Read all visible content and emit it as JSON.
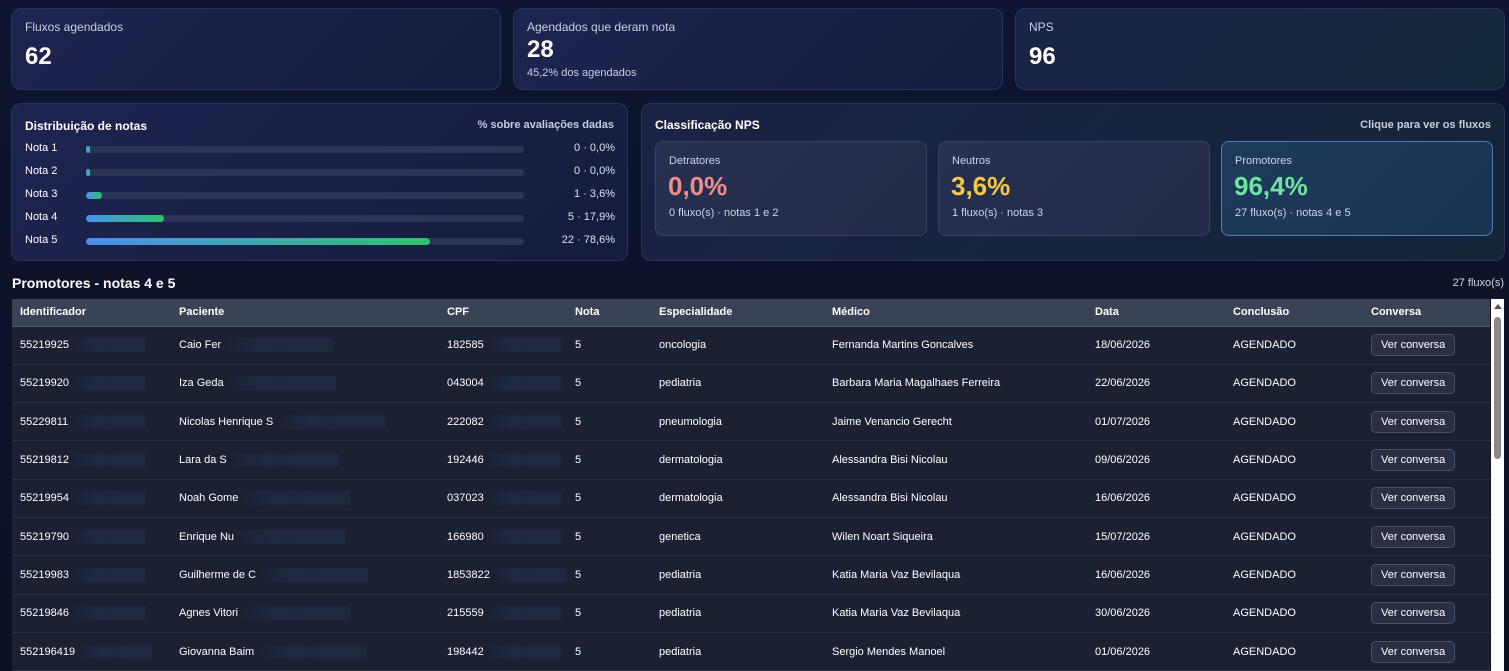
{
  "kpis": [
    {
      "label": "Fluxos agendados",
      "value": "62",
      "sub": ""
    },
    {
      "label": "Agendados que deram nota",
      "value": "28",
      "sub": "45,2% dos agendados"
    },
    {
      "label": "NPS",
      "value": "96",
      "sub": ""
    }
  ],
  "distribution": {
    "title": "Distribuição de notas",
    "hint": "% sobre avaliações dadas",
    "rows": [
      {
        "label": "Nota 1",
        "value_text": "0 · 0,0%",
        "fraction": 0.0
      },
      {
        "label": "Nota 2",
        "value_text": "0 · 0,0%",
        "fraction": 0.0
      },
      {
        "label": "Nota 3",
        "value_text": "1 · 3,6%",
        "fraction": 0.036
      },
      {
        "label": "Nota 4",
        "value_text": "5 · 17,9%",
        "fraction": 0.179
      },
      {
        "label": "Nota 5",
        "value_text": "22 · 78,6%",
        "fraction": 0.786
      }
    ]
  },
  "nps_classification": {
    "title": "Classificação NPS",
    "hint": "Clique para ver os fluxos",
    "boxes": [
      {
        "label": "Detratores",
        "value": "0,0%",
        "sub": "0 fluxo(s) · notas 1 e 2",
        "color": "#f28b8b"
      },
      {
        "label": "Neutros",
        "value": "3,6%",
        "sub": "1 fluxo(s) · notas 3",
        "color": "#f5c842"
      },
      {
        "label": "Promotores",
        "value": "96,4%",
        "sub": "27 fluxo(s) · notas 4 e 5",
        "color": "#6fe3a0"
      }
    ]
  },
  "section": {
    "title": "Promotores - notas 4 e 5",
    "count": "27 fluxo(s)"
  },
  "table": {
    "columns": [
      "Identificador",
      "Paciente",
      "CPF",
      "Nota",
      "Especialidade",
      "Médico",
      "Data",
      "Conclusão",
      "Conversa"
    ],
    "button_label": "Ver conversa",
    "rows": [
      {
        "id": "55219925",
        "paciente": "Caio Fer",
        "cpf": "182585",
        "nota": "5",
        "esp": "oncologia",
        "medico": "Fernanda Martins Goncalves",
        "data": "18/06/2026",
        "conclusao": "AGENDADO"
      },
      {
        "id": "55219920",
        "paciente": "Iza Geda",
        "cpf": "043004",
        "nota": "5",
        "esp": "pediatria",
        "medico": "Barbara Maria Magalhaes Ferreira",
        "data": "22/06/2026",
        "conclusao": "AGENDADO"
      },
      {
        "id": "55229811",
        "paciente": "Nicolas Henrique S",
        "cpf": "222082",
        "nota": "5",
        "esp": "pneumologia",
        "medico": "Jaime Venancio Gerecht",
        "data": "01/07/2026",
        "conclusao": "AGENDADO"
      },
      {
        "id": "55219812",
        "paciente": "Lara da S",
        "cpf": "192446",
        "nota": "5",
        "esp": "dermatologia",
        "medico": "Alessandra Bisi Nicolau",
        "data": "09/06/2026",
        "conclusao": "AGENDADO"
      },
      {
        "id": "55219954",
        "paciente": "Noah Gome",
        "cpf": "037023",
        "nota": "5",
        "esp": "dermatologia",
        "medico": "Alessandra Bisi Nicolau",
        "data": "16/06/2026",
        "conclusao": "AGENDADO"
      },
      {
        "id": "55219790",
        "paciente": "Enrique Nu",
        "cpf": "166980",
        "nota": "5",
        "esp": "genetica",
        "medico": "Wilen Noart Siqueira",
        "data": "15/07/2026",
        "conclusao": "AGENDADO"
      },
      {
        "id": "55219983",
        "paciente": "Guilherme de C",
        "cpf": "1853822",
        "nota": "5",
        "esp": "pediatria",
        "medico": "Katia Maria Vaz Bevilaqua",
        "data": "16/06/2026",
        "conclusao": "AGENDADO"
      },
      {
        "id": "55219846",
        "paciente": "Agnes Vitori",
        "cpf": "215559",
        "nota": "5",
        "esp": "pediatria",
        "medico": "Katia Maria Vaz Bevilaqua",
        "data": "30/06/2026",
        "conclusao": "AGENDADO"
      },
      {
        "id": "552196419",
        "paciente": "Giovanna Baim",
        "cpf": "198442",
        "nota": "5",
        "esp": "pediatria",
        "medico": "Sergio Mendes Manoel",
        "data": "01/06/2026",
        "conclusao": "AGENDADO"
      }
    ]
  }
}
